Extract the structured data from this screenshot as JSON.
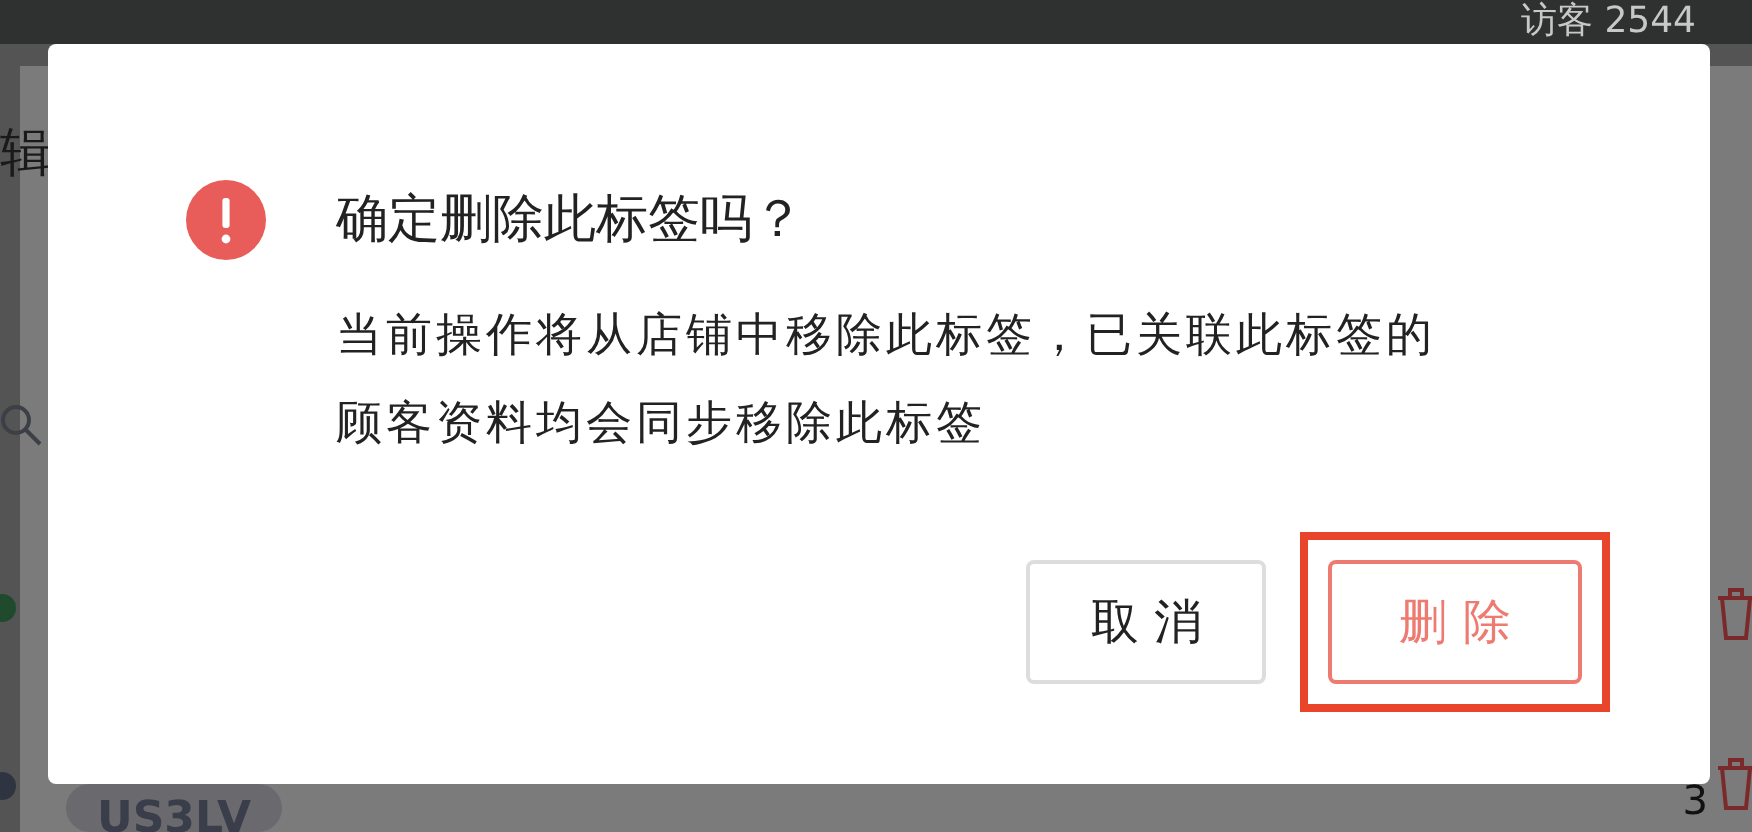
{
  "background": {
    "visitors": "访客 2544",
    "heading": "辑",
    "tag_chip": "US3LV",
    "count": "3",
    "dots": [
      {
        "color": "#1f4a2e"
      },
      {
        "color": "#2e3440"
      }
    ]
  },
  "dialog": {
    "title": "确定删除此标签吗？",
    "message": "当前操作将从店铺中移除此标签，已关联此标签的顾客资料均会同步移除此标签",
    "buttons": [
      {
        "label": "取 消",
        "kind": "default",
        "highlighted": false
      },
      {
        "label": "删 除",
        "kind": "danger",
        "highlighted": true
      }
    ]
  }
}
